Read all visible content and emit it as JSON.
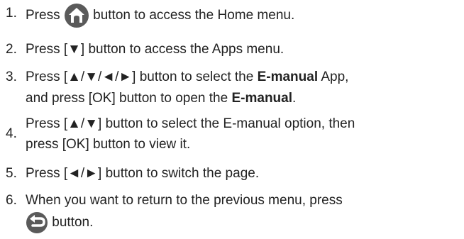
{
  "steps": [
    {
      "num": "1.",
      "parts": {
        "a": "Press",
        "b": "button to access the Home menu."
      }
    },
    {
      "num": "2.",
      "text": "Press [▼] button to access the Apps menu."
    },
    {
      "num": "3.",
      "line1a": "Press [▲/▼/◄/►] button to select the",
      "bold1": "E-manual",
      "line1b": "App,",
      "line2a": "and press [OK] button to open the",
      "bold2": "E-manual",
      "line2b": "."
    },
    {
      "num": "4.",
      "line1": "Press [▲/▼] button to select the E-manual option, then",
      "line2": "press [OK] button to view it."
    },
    {
      "num": "5.",
      "text": "Press [◄/►] button to switch the page."
    },
    {
      "num": "6.",
      "line1": "When you want to return to the previous menu, press",
      "line2": "button."
    }
  ],
  "icons": {
    "home": "home-icon",
    "back": "back-icon"
  },
  "colors": {
    "icon_fill": "#5a5a5a",
    "text": "#222222"
  }
}
